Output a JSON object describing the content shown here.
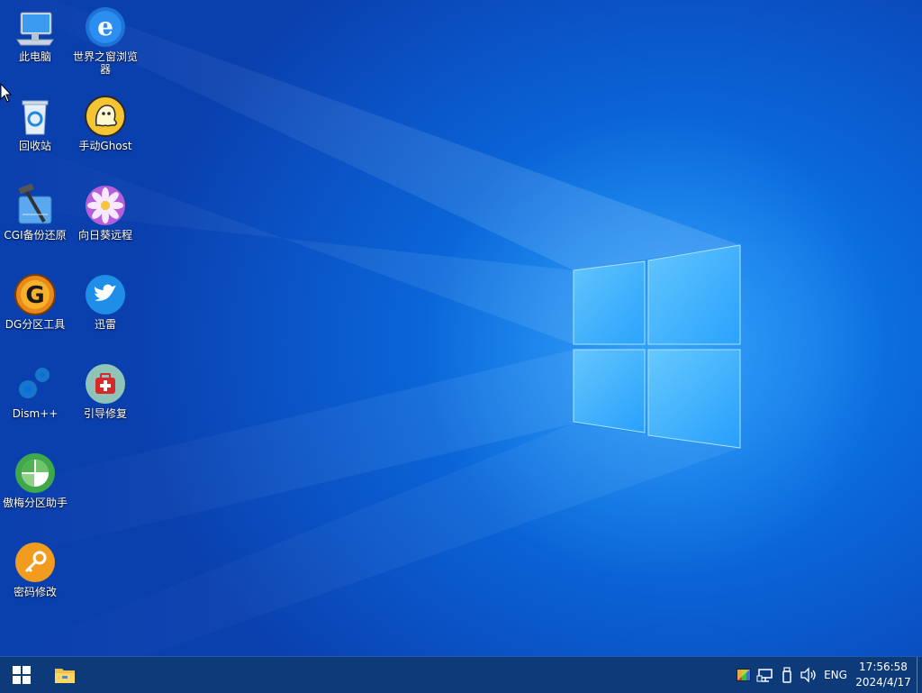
{
  "desktop": {
    "icons": [
      {
        "label": "此电脑",
        "icon": "computer-icon"
      },
      {
        "label": "世界之窗浏览器",
        "icon": "browser-icon"
      },
      {
        "label": "回收站",
        "icon": "recycle-bin-icon"
      },
      {
        "label": "手动Ghost",
        "icon": "ghost-icon"
      },
      {
        "label": "CGI备份还原",
        "icon": "backup-tool-icon"
      },
      {
        "label": "向日葵远程",
        "icon": "sunflower-icon"
      },
      {
        "label": "DG分区工具",
        "icon": "diskgenius-icon"
      },
      {
        "label": "迅雷",
        "icon": "thunder-icon"
      },
      {
        "label": "Dism++",
        "icon": "dism-gear-icon"
      },
      {
        "label": "引导修复",
        "icon": "boot-repair-icon"
      },
      {
        "label": "傲梅分区助手",
        "icon": "partition-assistant-icon"
      },
      {
        "label": "密码修改",
        "icon": "password-key-icon"
      }
    ]
  },
  "taskbar": {
    "start": "windows-logo-icon",
    "pinned": [
      "file-explorer-icon"
    ],
    "tray": {
      "icons": [
        "color-display-icon",
        "network-icon",
        "usb-icon",
        "volume-icon"
      ],
      "language": "ENG",
      "time": "17:56:58",
      "date": "2024/4/17"
    }
  },
  "colors": {
    "taskbar": "#0d3a78",
    "wallpaper_accent": "#1e8cf5"
  }
}
